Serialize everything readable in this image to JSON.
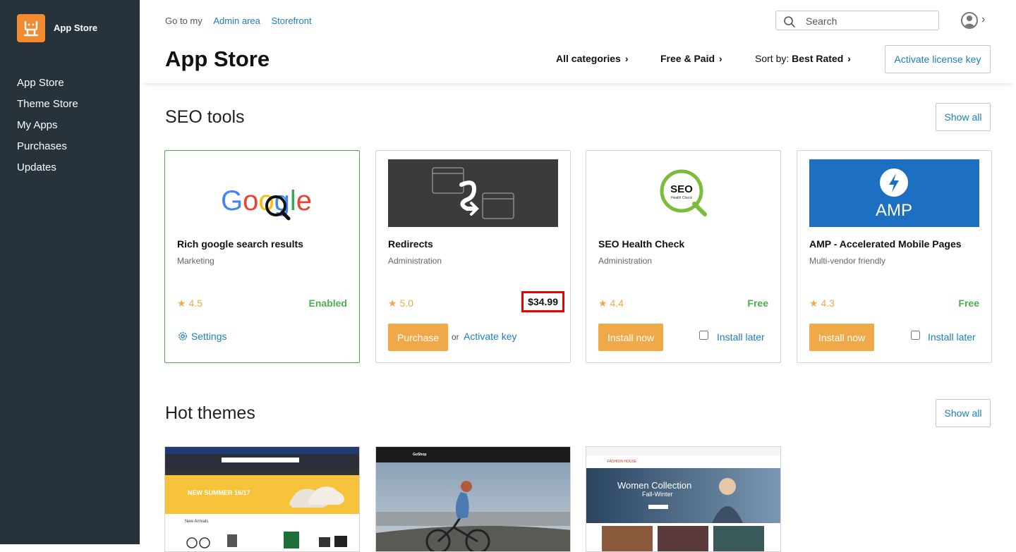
{
  "sidebar": {
    "logo_text": "App Store",
    "items": [
      {
        "label": "App Store"
      },
      {
        "label": "Theme Store"
      },
      {
        "label": "My Apps"
      },
      {
        "label": "Purchases"
      },
      {
        "label": "Updates"
      }
    ]
  },
  "header": {
    "goto_label": "Go to my",
    "admin_link": "Admin area",
    "storefront_link": "Storefront",
    "search_placeholder": "Search",
    "title": "App Store",
    "filters": {
      "categories": "All categories",
      "price": "Free & Paid",
      "sort_label": "Sort by:",
      "sort_value": "Best Rated"
    },
    "activate_button": "Activate license key"
  },
  "seo_section": {
    "title": "SEO tools",
    "show_all": "Show all",
    "cards": [
      {
        "name": "Rich google search results",
        "category": "Marketing",
        "rating": "4.5",
        "status": "Enabled",
        "action": "Settings"
      },
      {
        "name": "Redirects",
        "category": "Administration",
        "rating": "5.0",
        "price": "$34.99",
        "action": "Purchase",
        "or_text": "or",
        "secondary": "Activate key"
      },
      {
        "name": "SEO Health Check",
        "category": "Administration",
        "rating": "4.4",
        "status": "Free",
        "action": "Install now",
        "secondary": "Install later",
        "logo_text": "SEO",
        "logo_subtext": "Health Check"
      },
      {
        "name": "AMP - Accelerated Mobile Pages",
        "category": "Multi-vendor friendly",
        "rating": "4.3",
        "status": "Free",
        "action": "Install now",
        "secondary": "Install later",
        "logo_text": "AMP"
      }
    ]
  },
  "themes_section": {
    "title": "Hot themes",
    "show_all": "Show all",
    "themes": [
      {
        "banner_text": "NEW SUMMER 16/17",
        "sub_text": "New Arrivals"
      },
      {
        "brand": "GoShop"
      },
      {
        "headline": "Women Collection",
        "subline": "Fall-Winter",
        "brand": "FASHION HOUSE"
      }
    ]
  },
  "colors": {
    "sidebar_bg": "#27323b",
    "accent_orange": "#f0a948",
    "link_blue": "#1a7fc1",
    "success_green": "#4caf50",
    "price_highlight": "#e00000"
  }
}
